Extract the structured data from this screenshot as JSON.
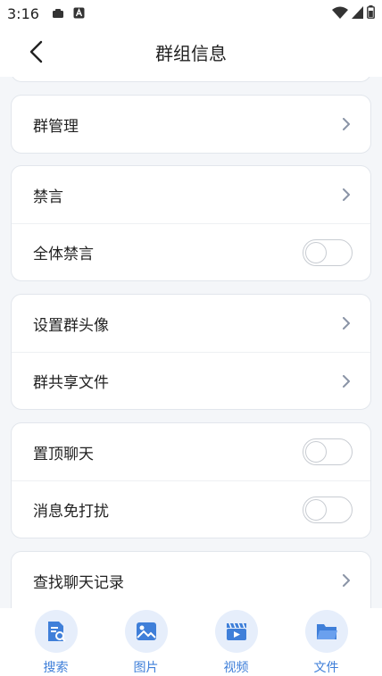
{
  "status_bar": {
    "time": "3:16"
  },
  "header": {
    "title": "群组信息"
  },
  "sections": {
    "manage": {
      "label": "群管理"
    },
    "mute": {
      "label": "禁言"
    },
    "mute_all": {
      "label": "全体禁言",
      "enabled": false
    },
    "set_avatar": {
      "label": "设置群头像"
    },
    "shared_files": {
      "label": "群共享文件"
    },
    "pin_chat": {
      "label": "置顶聊天",
      "enabled": false
    },
    "do_not_disturb": {
      "label": "消息免打扰",
      "enabled": false
    },
    "search_history": {
      "label": "查找聊天记录"
    }
  },
  "bottom_tools": [
    {
      "label": "搜索",
      "icon": "search-doc-icon"
    },
    {
      "label": "图片",
      "icon": "image-icon"
    },
    {
      "label": "视频",
      "icon": "video-icon"
    },
    {
      "label": "文件",
      "icon": "folder-icon"
    }
  ],
  "colors": {
    "accent": "#3f7fd9",
    "tool_bg": "#e6eefb",
    "page_bg": "#f4f6f9"
  }
}
